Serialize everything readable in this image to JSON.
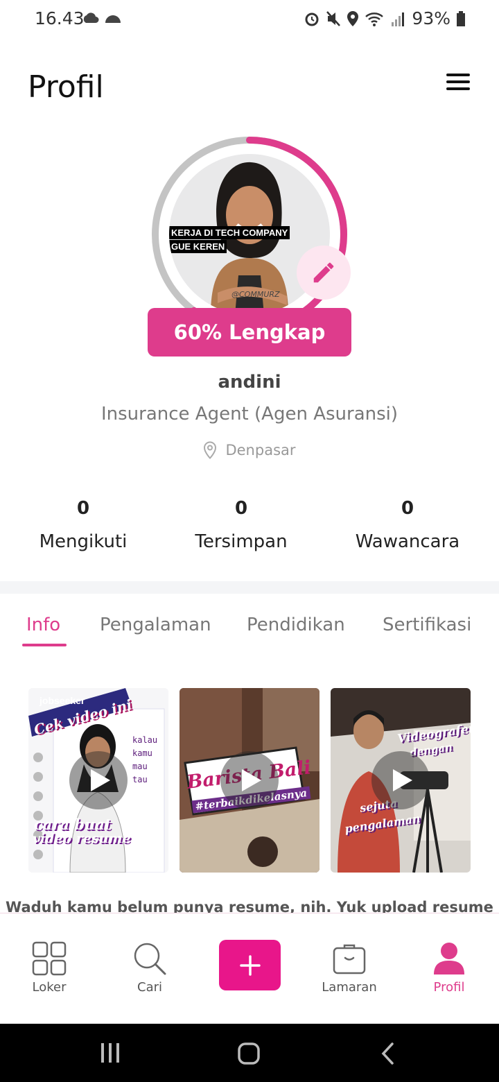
{
  "status_bar": {
    "time": "16.43",
    "battery": "93%"
  },
  "header": {
    "title": "Profil"
  },
  "profile": {
    "photo_caption_line1": "KERJA DI TECH COMPANY",
    "photo_caption_line2": "GUE KEREN",
    "photo_watermark": "@COMMURZ",
    "completion_label": "60% Lengkap",
    "completion_percent": 60,
    "name": "andini",
    "job_title": "Insurance Agent (Agen Asuransi)",
    "location": "Denpasar"
  },
  "stats": [
    {
      "value": "0",
      "label": "Mengikuti"
    },
    {
      "value": "0",
      "label": "Tersimpan"
    },
    {
      "value": "0",
      "label": "Wawancara"
    }
  ],
  "tabs": [
    {
      "label": "Info",
      "active": true
    },
    {
      "label": "Pengalaman",
      "active": false
    },
    {
      "label": "Pendidikan",
      "active": false
    },
    {
      "label": "Sertifikasi",
      "active": false
    }
  ],
  "videos": [
    {
      "cap1": "Cek video ini",
      "cap2": "cara buat",
      "cap3": "video resume",
      "side": [
        "kalau",
        "kamu",
        "mau",
        "tau"
      ],
      "logo": "jobseeker"
    },
    {
      "cap1": "Barista Bali",
      "cap2": "#terbaikdikelasnya"
    },
    {
      "cap1": "Videografer",
      "cap2": "dengan",
      "cap3": "sejuta",
      "cap4": "pengalaman"
    }
  ],
  "notice": "Waduh kamu belum punya resume, nih. Yuk upload resume",
  "bottom_nav": [
    {
      "label": "Loker",
      "icon": "grid-icon"
    },
    {
      "label": "Cari",
      "icon": "search-icon"
    },
    {
      "label": "",
      "icon": "plus-icon"
    },
    {
      "label": "Lamaran",
      "icon": "briefcase-icon"
    },
    {
      "label": "Profil",
      "icon": "user-icon"
    }
  ],
  "colors": {
    "accent": "#de3c8c",
    "fab": "#e8168a",
    "progress_track": "#c4c4c4"
  }
}
